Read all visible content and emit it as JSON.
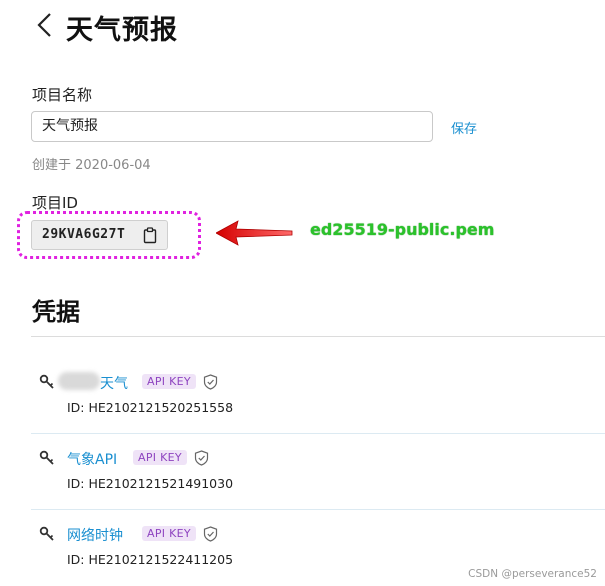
{
  "header": {
    "title": "天气预报"
  },
  "project": {
    "name_label": "项目名称",
    "name_value": "天气预报",
    "save_label": "保存",
    "created": "创建于 2020-06-04",
    "id_label": "项目ID",
    "id_value": "29KVA6G27T"
  },
  "annotation": {
    "text": "ed25519-public.pem",
    "color": "#2bc22b",
    "arrow_color": "#e00000"
  },
  "credentials": {
    "title": "凭据",
    "items": [
      {
        "name": "天气",
        "badge": "API KEY",
        "id": "ID: HE2102121520251558"
      },
      {
        "name": "气象API",
        "badge": "API KEY",
        "id": "ID: HE2102121521491030"
      },
      {
        "name": "网络时钟",
        "badge": "API KEY",
        "id": "ID: HE2102121522411205"
      }
    ]
  },
  "watermark": "CSDN @perseverance52",
  "colors": {
    "accent": "#1a8fd0",
    "badge_text": "#8e44c0",
    "badge_bg": "#efe3f7",
    "highlight": "#e022e0"
  }
}
